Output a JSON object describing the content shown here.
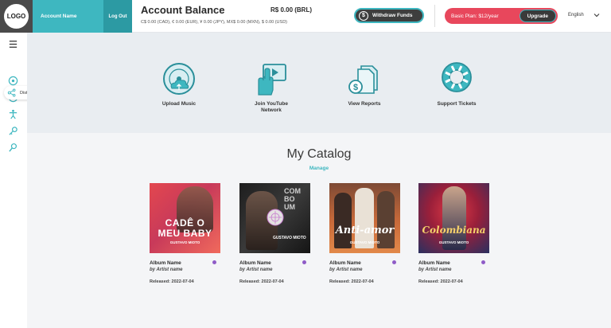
{
  "header": {
    "logo": "LOGO",
    "account_name": "Account Name",
    "logout": "Log Out",
    "balance_title": "Account Balance",
    "balance_main": "R$ 0.00 (BRL)",
    "balance_sub": "C$ 0.00 (CAD),   € 0.00 (EUR),   ¥ 0.00 (JPY),   MX$ 0.00 (MXN),   $ 0.00 (USD)",
    "withdraw": "Withdraw Funds",
    "plan": "Basic Plan: $12/year",
    "upgrade": "Upgrade",
    "language": "English",
    "accent": "#3eb7c0",
    "plan_color": "#e8475c"
  },
  "sidebar": {
    "distribution_label": "Distribution",
    "icons": [
      "menu-icon",
      "distribution-icon",
      "disc-icon",
      "publishing-icon",
      "person-icon",
      "key-icon",
      "search-person-icon"
    ]
  },
  "actions": [
    {
      "label": "Upload Music",
      "icon": "cd-upload-icon"
    },
    {
      "label": "Join YouTube\nNetwork",
      "icon": "youtube-hand-icon"
    },
    {
      "label": "View Reports",
      "icon": "reports-icon"
    },
    {
      "label": "Support Tickets",
      "icon": "lifebuoy-icon"
    }
  ],
  "catalog": {
    "title": "My Catalog",
    "manage": "Manage",
    "albums": [
      {
        "name": "Album Name",
        "artist": "by Artist name",
        "released": "Released: 2022-07-04",
        "cover_text": "CADÊ O\nMEU BABY",
        "cover_sub": "GUSTAVO MIOTO"
      },
      {
        "name": "Album Name",
        "artist": "by Artist name",
        "released": "Released: 2022-07-04",
        "cover_text": "",
        "cover_sub": "GUSTAVO MIOTO"
      },
      {
        "name": "Album Name",
        "artist": "by Artist name",
        "released": "Released: 2022-07-04",
        "cover_text": "Anti-amor",
        "cover_sub": "GUSTAVO MIOTO"
      },
      {
        "name": "Album Name",
        "artist": "by Artist name",
        "released": "Released: 2022-07-04",
        "cover_text": "Colombiana",
        "cover_sub": "GUSTAVO MIOTO"
      }
    ]
  }
}
